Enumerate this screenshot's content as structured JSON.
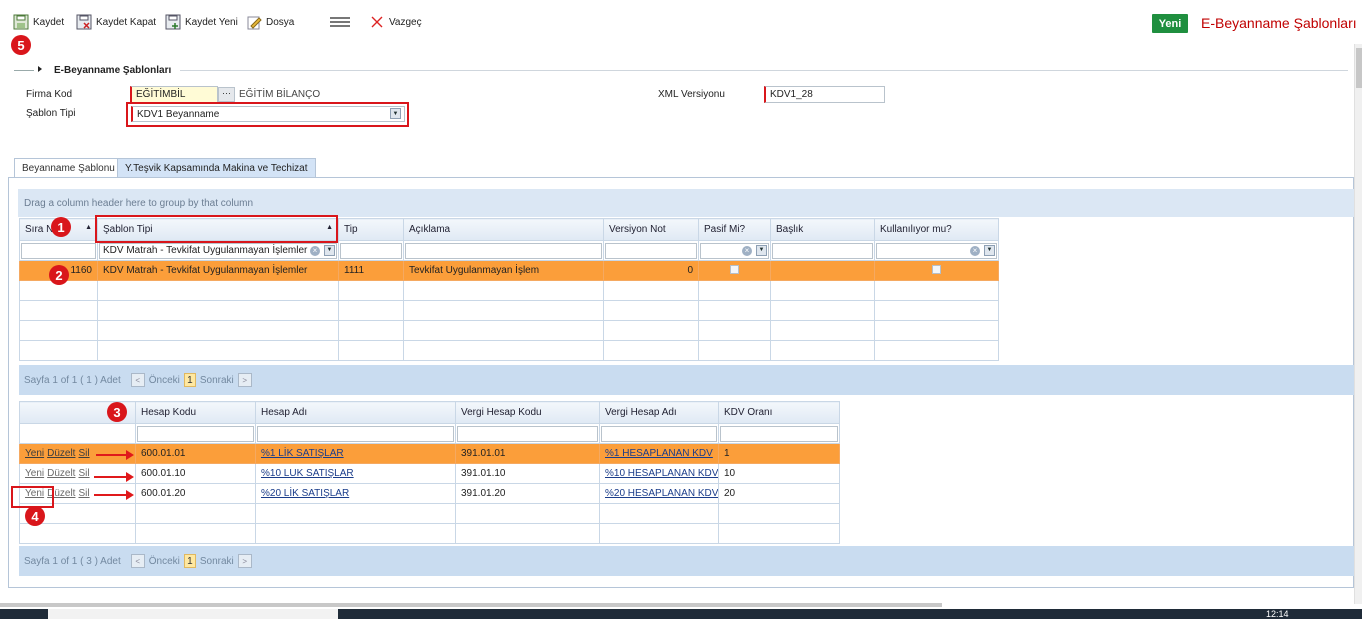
{
  "toolbar": {
    "save": "Kaydet",
    "save_close": "Kaydet Kapat",
    "save_new": "Kaydet Yeni",
    "file": "Dosya",
    "cancel": "Vazgeç",
    "new_button": "Yeni",
    "title": "E-Beyanname Şablonları"
  },
  "badges": {
    "b1": "1",
    "b2": "2",
    "b3": "3",
    "b4": "4",
    "b5": "5"
  },
  "section": {
    "title": "E-Beyanname Şablonları"
  },
  "form": {
    "firma_kod_label": "Firma Kod",
    "firma_kod_value": "EĞİTİMBİL",
    "firma_name": "EĞİTİM BİLANÇO",
    "sablon_tipi_label": "Şablon Tipi",
    "sablon_tipi_value": "KDV1 Beyanname",
    "xml_label": "XML Versiyonu",
    "xml_value": "KDV1_28"
  },
  "tabs": [
    {
      "label": "Beyanname Şablonu",
      "active": true
    },
    {
      "label": "Y.Teşvik Kapsamında Makina ve Techizat",
      "active": false
    }
  ],
  "grid1": {
    "group_hint": "Drag a column header here to group by that column",
    "columns": [
      "Sıra No",
      "Şablon Tipi",
      "Tip",
      "Açıklama",
      "Versiyon Not",
      "Pasif Mi?",
      "Başlık",
      "Kullanılıyor mu?"
    ],
    "filter_sablon": "KDV Matrah - Tevkifat Uygulanmayan İşlemler",
    "rows": [
      {
        "sira": "1160",
        "sablon": "KDV Matrah - Tevkifat Uygulanmayan İşlemler",
        "tip": "1111",
        "aciklama": "Tevkifat Uygulanmayan İşlem",
        "versiyon": "0"
      }
    ],
    "pager": {
      "info": "Sayfa 1 of 1 ( 1 ) Adet",
      "prev": "Önceki",
      "page": "1",
      "next": "Sonraki"
    }
  },
  "grid2": {
    "columns": [
      "Hesap Kodu",
      "Hesap Adı",
      "Vergi Hesap Kodu",
      "Vergi Hesap Adı",
      "KDV Oranı"
    ],
    "actions": {
      "new": "Yeni",
      "edit": "Düzelt",
      "delete": "Sil"
    },
    "rows": [
      {
        "kod": "600.01.01",
        "ad": "%1 LİK SATIŞLAR",
        "vkod": "391.01.01",
        "vad": "%1 HESAPLANAN KDV",
        "oran": "1"
      },
      {
        "kod": "600.01.10",
        "ad": "%10 LUK SATIŞLAR",
        "vkod": "391.01.10",
        "vad": "%10 HESAPLANAN KDV",
        "oran": "10"
      },
      {
        "kod": "600.01.20",
        "ad": "%20 LİK SATIŞLAR",
        "vkod": "391.01.20",
        "vad": "%20 HESAPLANAN KDV",
        "oran": "20"
      }
    ],
    "pager": {
      "info": "Sayfa 1 of 1 ( 3 ) Adet",
      "prev": "Önceki",
      "page": "1",
      "next": "Sonraki"
    }
  },
  "taskbar": {
    "clock": "12:14"
  }
}
